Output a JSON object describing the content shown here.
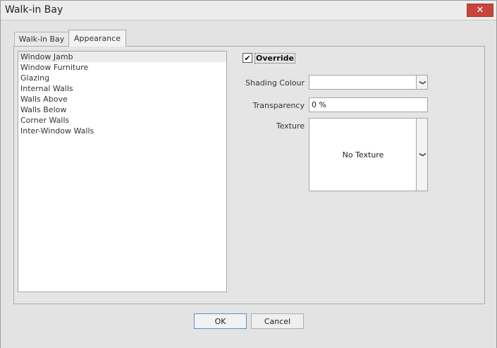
{
  "window": {
    "title": "Walk-in Bay",
    "close_glyph": "✕"
  },
  "tabs": [
    {
      "label": "Walk-in Bay",
      "active": false
    },
    {
      "label": "Appearance",
      "active": true
    }
  ],
  "list": {
    "selected_index": 0,
    "items": [
      "Window Jamb",
      "Window Furniture",
      "Glazing",
      "Internal Walls",
      "Walls Above",
      "Walls Below",
      "Corner Walls",
      "Inter-Window Walls"
    ]
  },
  "appearance": {
    "override_label": "Override",
    "override_checked": true,
    "check_glyph": "✔",
    "shading_colour_label": "Shading Colour",
    "shading_colour_value": "",
    "transparency_label": "Transparency",
    "transparency_value": "0 %",
    "texture_label": "Texture",
    "texture_value": "No Texture",
    "dropdown_glyph": "❯"
  },
  "buttons": {
    "ok": "OK",
    "cancel": "Cancel"
  },
  "icons": {
    "close": "close-icon",
    "checkmark": "checkmark-icon",
    "dropdown": "chevron-down-icon"
  }
}
